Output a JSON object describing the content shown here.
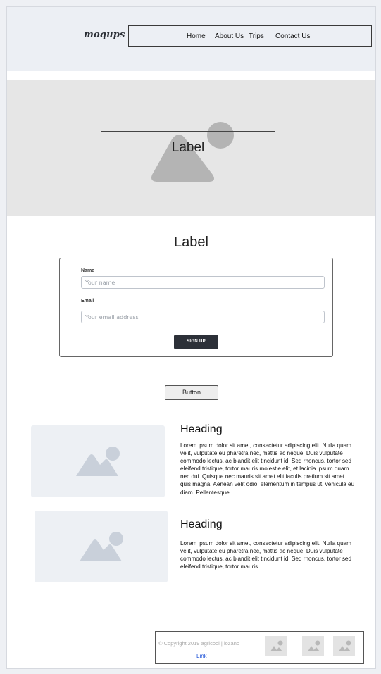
{
  "header": {
    "logo": "moqups",
    "nav": [
      "Home",
      "About Us",
      "Trips",
      "Contact Us"
    ]
  },
  "hero": {
    "label": "Label",
    "image_icon": "image-placeholder-icon"
  },
  "form": {
    "title": "Label",
    "name_label": "Name",
    "name_placeholder": "Your name",
    "email_label": "Email",
    "email_placeholder": "Your email address",
    "submit": "SIGN UP"
  },
  "button": {
    "label": "Button"
  },
  "cards": [
    {
      "heading": "Heading",
      "text": "Lorem ipsum dolor sit amet, consectetur adipiscing elit. Nulla quam velit, vulputate eu pharetra nec, mattis ac neque. Duis vulputate commodo lectus, ac blandit elit tincidunt id. Sed rhoncus, tortor sed eleifend tristique, tortor mauris molestie elit, et lacinia ipsum quam nec dui. Quisque nec mauris sit amet elit iaculis pretium sit amet quis magna. Aenean velit odio, elementum in tempus ut, vehicula eu diam. Pellentesque"
    },
    {
      "heading": "Heading",
      "text": "Lorem ipsum dolor sit amet, consectetur adipiscing elit. Nulla quam velit, vulputate eu pharetra nec, mattis ac neque. Duis vulputate commodo lectus, ac blandit elit tincidunt id. Sed rhoncus, tortor sed eleifend tristique, tortor mauris"
    }
  ],
  "footer": {
    "copyright": "© Copyright 2019 agricool | lozano",
    "link": "Link"
  },
  "colors": {
    "header_bg": "#eceff4",
    "hero_bg": "#e6e6e6",
    "signup_bg": "#2c3038",
    "link": "#1a4fd6"
  }
}
